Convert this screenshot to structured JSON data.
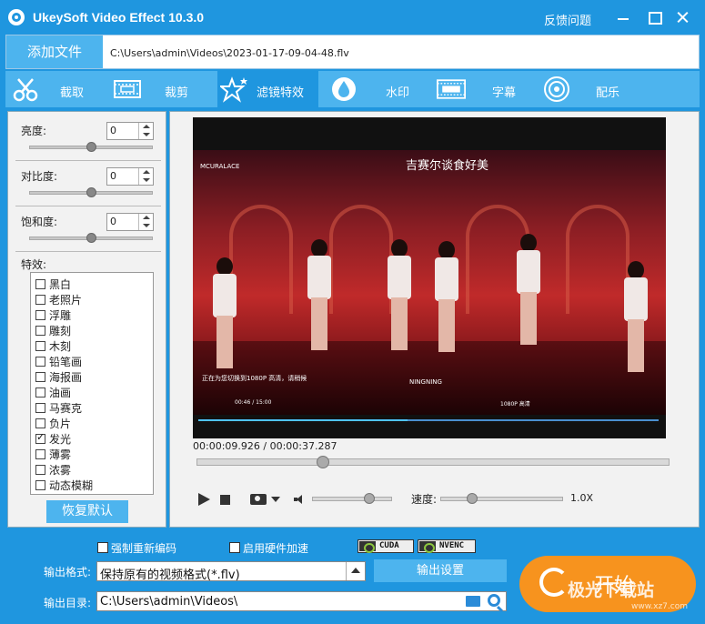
{
  "titlebar": {
    "title": "UkeySoft Video Effect 10.3.0",
    "feedback": "反馈问题"
  },
  "file": {
    "add_label": "添加文件",
    "path": "C:\\Users\\admin\\Videos\\2023-01-17-09-04-48.flv"
  },
  "toolbar": {
    "items": [
      {
        "label": "截取",
        "icon": "scissors-icon"
      },
      {
        "label": "裁剪",
        "icon": "crop-icon"
      },
      {
        "label": "滤镜特效",
        "icon": "star-icon",
        "active": true
      },
      {
        "label": "水印",
        "icon": "drop-icon"
      },
      {
        "label": "字幕",
        "icon": "subtitle-icon"
      },
      {
        "label": "配乐",
        "icon": "music-icon"
      }
    ]
  },
  "adjust": {
    "brightness_label": "亮度:",
    "brightness_value": "0",
    "brightness_level": 0.5,
    "contrast_label": "对比度:",
    "contrast_value": "0",
    "contrast_level": 0.5,
    "saturation_label": "饱和度:",
    "saturation_value": "0",
    "saturation_level": 0.5
  },
  "effects": {
    "label": "特效:",
    "items": [
      {
        "label": "黑白",
        "checked": false
      },
      {
        "label": "老照片",
        "checked": false
      },
      {
        "label": "浮雕",
        "checked": false
      },
      {
        "label": "雕刻",
        "checked": false
      },
      {
        "label": "木刻",
        "checked": false
      },
      {
        "label": "铅笔画",
        "checked": false
      },
      {
        "label": "海报画",
        "checked": false
      },
      {
        "label": "油画",
        "checked": false
      },
      {
        "label": "马赛克",
        "checked": false
      },
      {
        "label": "负片",
        "checked": false
      },
      {
        "label": "发光",
        "checked": true
      },
      {
        "label": "薄雾",
        "checked": false
      },
      {
        "label": "浓雾",
        "checked": false
      },
      {
        "label": "动态模糊",
        "checked": false
      }
    ],
    "restore_label": "恢复默认"
  },
  "player": {
    "video_caption": "吉赛尔谈食好美",
    "video_badge": "MCURALACE",
    "video_info": "正在为您切换到1080P 高清，请稍候",
    "video_artist": "NINGNING",
    "video_time": "00:46 / 15:00",
    "video_quality": "1080P 高清",
    "timecode": "00:00:09.926 / 00:00:37.287",
    "seek_fraction": 0.266,
    "volume_level": 0.7,
    "speed_label": "速度:",
    "speed_value": "1.0X",
    "speed_level": 0.25
  },
  "output": {
    "force_reencode_label": "强制重新编码",
    "force_reencode_checked": false,
    "hw_accel_label": "启用硬件加速",
    "hw_accel_checked": false,
    "cuda_label": "CUDA",
    "nvenc_label": "NVENC",
    "format_label": "输出格式:",
    "format_value": "保持原有的视频格式(*.flv)",
    "settings_label": "输出设置",
    "dir_label": "输出目录:",
    "dir_value": "C:\\Users\\admin\\Videos\\",
    "start_label": "开始"
  },
  "watermark": {
    "text": "极光下载站",
    "url": "www.xz7.com"
  },
  "colors": {
    "primary": "#1f96df",
    "accent": "#4db4ee",
    "start": "#f7931e"
  }
}
